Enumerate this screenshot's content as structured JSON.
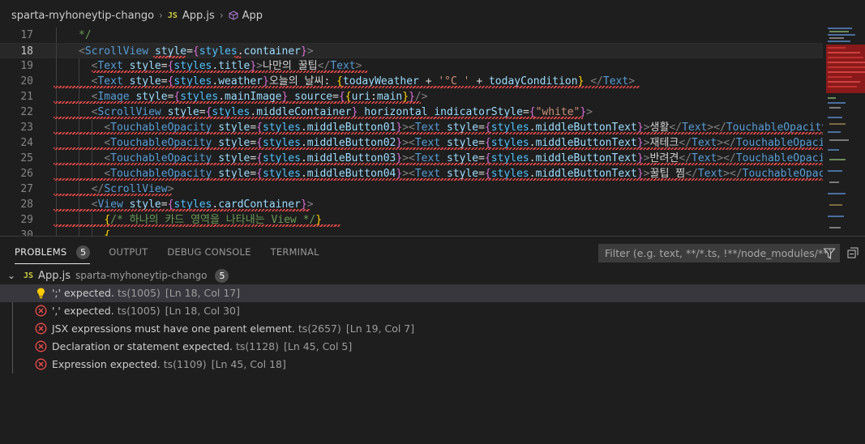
{
  "breadcrumb": {
    "project": "sparta-myhoneytip-chango",
    "file_badge": "JS",
    "file": "App.js",
    "symbol": "App"
  },
  "editor": {
    "lines": [
      {
        "num": "17"
      },
      {
        "num": "18"
      },
      {
        "num": "19"
      },
      {
        "num": "20"
      },
      {
        "num": "21"
      },
      {
        "num": "22"
      },
      {
        "num": "23"
      },
      {
        "num": "24"
      },
      {
        "num": "25"
      },
      {
        "num": "26"
      },
      {
        "num": "27"
      },
      {
        "num": "28"
      },
      {
        "num": "29"
      },
      {
        "num": "30"
      }
    ],
    "current_line": "18"
  },
  "panel": {
    "tabs": {
      "problems": "PROBLEMS",
      "problems_count": "5",
      "output": "OUTPUT",
      "debug": "DEBUG CONSOLE",
      "terminal": "TERMINAL"
    },
    "filter_placeholder": "Filter (e.g. text, **/*.ts, !**/node_modules/**)",
    "file": {
      "badge": "JS",
      "name": "App.js",
      "path": "sparta-myhoneytip-chango",
      "count": "5"
    },
    "problems": [
      {
        "severity": "warning",
        "message": "';' expected.",
        "code": "ts(1005)",
        "location": "[Ln 18, Col 17]"
      },
      {
        "severity": "error",
        "message": "',' expected.",
        "code": "ts(1005)",
        "location": "[Ln 18, Col 30]"
      },
      {
        "severity": "error",
        "message": "JSX expressions must have one parent element.",
        "code": "ts(2657)",
        "location": "[Ln 19, Col 7]"
      },
      {
        "severity": "error",
        "message": "Declaration or statement expected.",
        "code": "ts(1128)",
        "location": "[Ln 45, Col 5]"
      },
      {
        "severity": "error",
        "message": "Expression expected.",
        "code": "ts(1109)",
        "location": "[Ln 45, Col 18]"
      }
    ]
  },
  "colors": {
    "error": "#f14c4c",
    "warning": "#cca700",
    "background": "#1e1e1e"
  }
}
